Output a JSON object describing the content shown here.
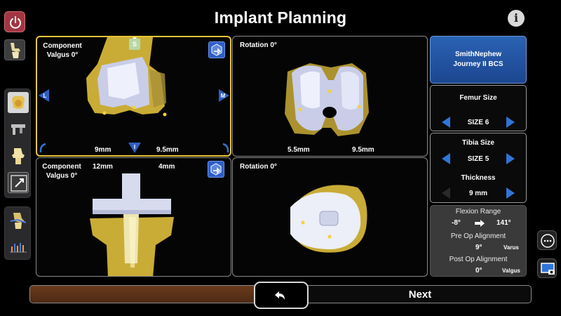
{
  "header": {
    "title": "Implant Planning",
    "info_glyph": "i"
  },
  "left_toolbar": {
    "power_icon": "power-icon",
    "knee_icon": "knee-icon",
    "tools": [
      "femur-implant-icon",
      "caliper-icon",
      "tibia-implant-icon",
      "resize-icon"
    ],
    "tools_b": [
      "ligament-balance-icon",
      "gap-chart-icon"
    ]
  },
  "views": {
    "femur_coronal": {
      "label_line1": "Component",
      "label_line2": "Valgus 0°",
      "top_marker": "S",
      "left_marker": "L",
      "right_marker": "M",
      "bottom_marker": "I",
      "resection_left": "9mm",
      "resection_right": "9.5mm"
    },
    "femur_axial": {
      "label": "Rotation 0°",
      "resection_left": "5.5mm",
      "resection_right": "9.5mm"
    },
    "tibia_coronal": {
      "label_line1": "Component",
      "label_line2": "Valgus 0°",
      "resection_left": "12mm",
      "resection_right": "4mm"
    },
    "tibia_axial": {
      "label": "Rotation 0°"
    }
  },
  "right_panel": {
    "brand_line1": "SmithNephew",
    "brand_line2": "Journey II BCS",
    "femur_size_label": "Femur Size",
    "femur_size_value": "SIZE 6",
    "tibia_size_label": "Tibia Size",
    "tibia_size_value": "SIZE 5",
    "thickness_label": "Thickness",
    "thickness_value": "9 mm",
    "flexion_range_label": "Flexion Range",
    "flexion_min": "-8°",
    "flexion_max": "141°",
    "pre_op_label": "Pre Op Alignment",
    "pre_op_value": "9°",
    "pre_op_unit": "Varus",
    "post_op_label": "Post Op Alignment",
    "post_op_value": "0°",
    "post_op_unit": "Valgus"
  },
  "footer": {
    "next_label": "Next",
    "back_icon": "undo-arrow-icon"
  },
  "colors": {
    "accent_blue": "#2f74d8",
    "selected_border": "#e8c53a",
    "bone": "#d6bc4e",
    "implant": "#c9cde8",
    "progress": "#6a3a1c"
  }
}
